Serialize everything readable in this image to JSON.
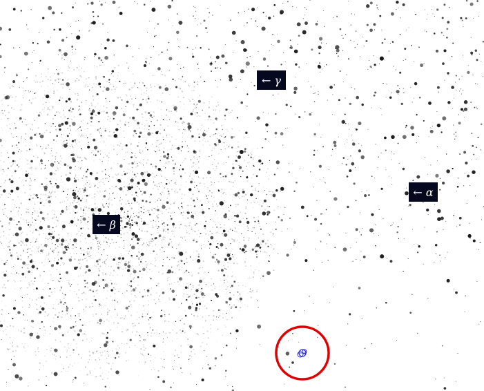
{
  "image": {
    "background": "#ffffff",
    "star_color": "#1a1a1a",
    "label_background": "#05081e",
    "label_text_color": "#ffffff",
    "marker_circle_color": "#e00000",
    "marker_symbol_color": "#2a2ad8"
  },
  "labels": [
    {
      "arrow": "←",
      "letter": "γ"
    },
    {
      "arrow": "←",
      "letter": "α"
    },
    {
      "arrow": "←",
      "letter": "β"
    }
  ]
}
